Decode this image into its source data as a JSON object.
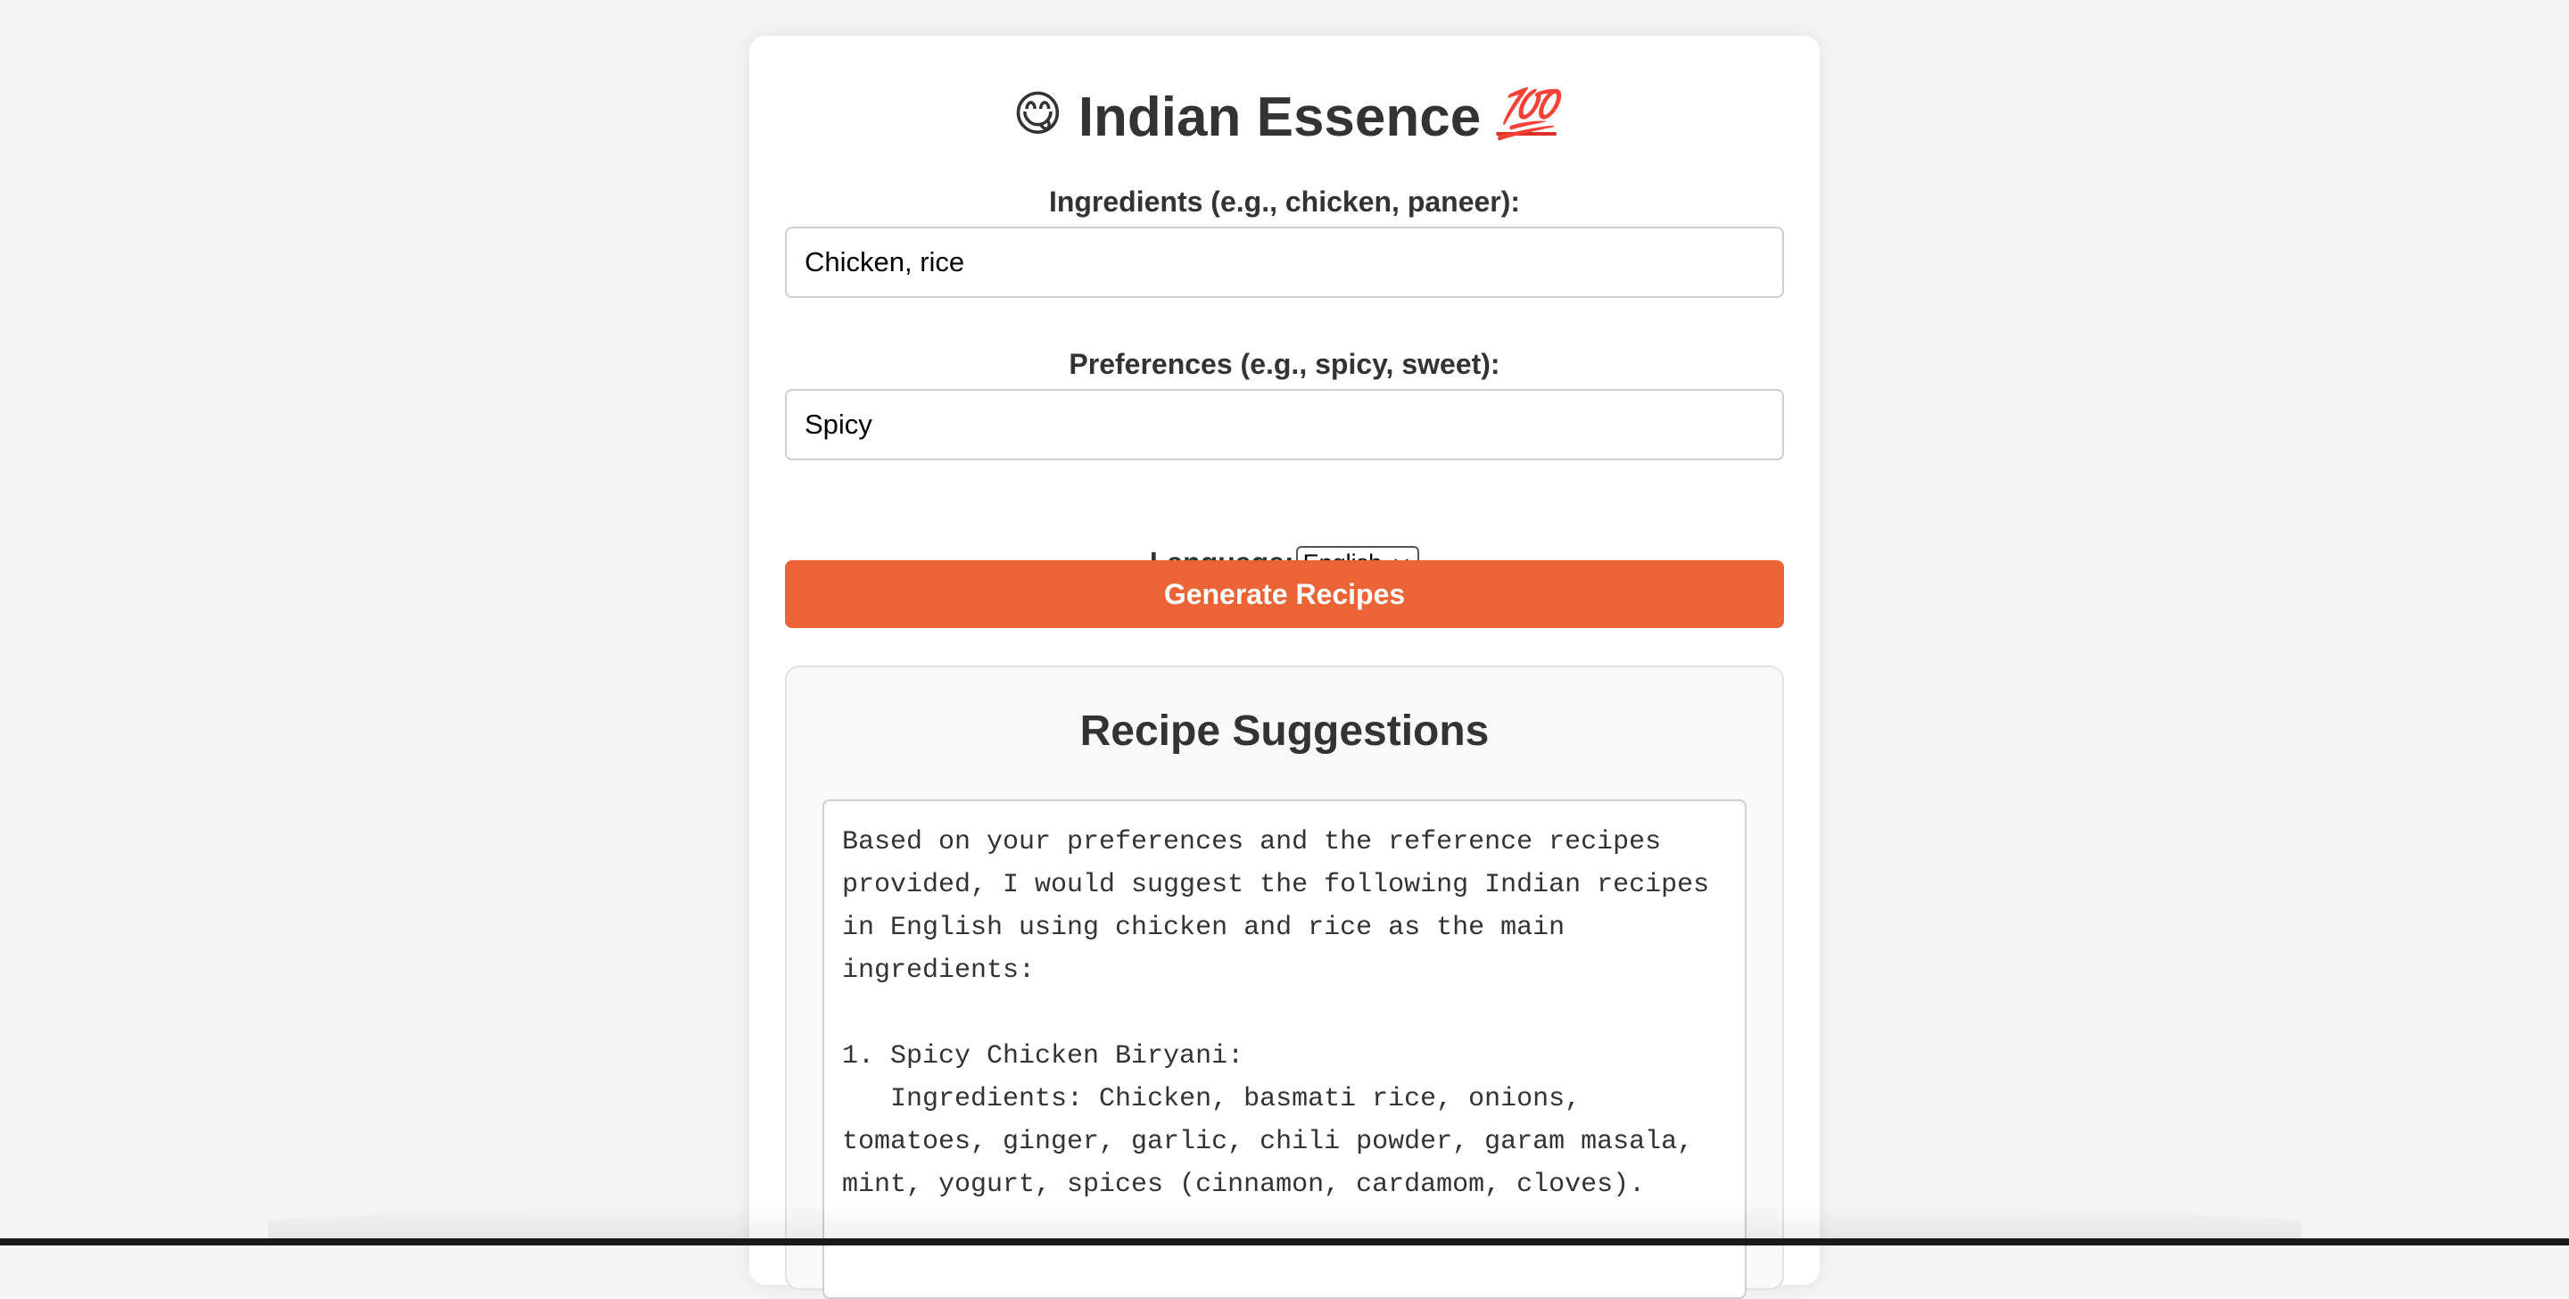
{
  "app": {
    "title_emoji_left": "😋",
    "title": "Indian Essence",
    "title_emoji_right": "💯"
  },
  "form": {
    "ingredients_label": "Ingredients (e.g., chicken, paneer):",
    "ingredients_value": "Chicken, rice",
    "preferences_label": "Preferences (e.g., spicy, sweet):",
    "preferences_value": "Spicy",
    "language_label": "Language:",
    "language_selected": "English",
    "generate_label": "Generate Recipes"
  },
  "results": {
    "title": "Recipe Suggestions",
    "text": "Based on your preferences and the reference recipes provided, I would suggest the following Indian recipes in English using chicken and rice as the main ingredients:\n\n1. Spicy Chicken Biryani:\n   Ingredients: Chicken, basmati rice, onions, tomatoes, ginger, garlic, chili powder, garam masala, mint, yogurt, spices (cinnamon, cardamom, cloves)."
  },
  "colors": {
    "accent": "#ec6336",
    "background": "#f4f4f4",
    "card": "#ffffff",
    "text": "#333333"
  }
}
